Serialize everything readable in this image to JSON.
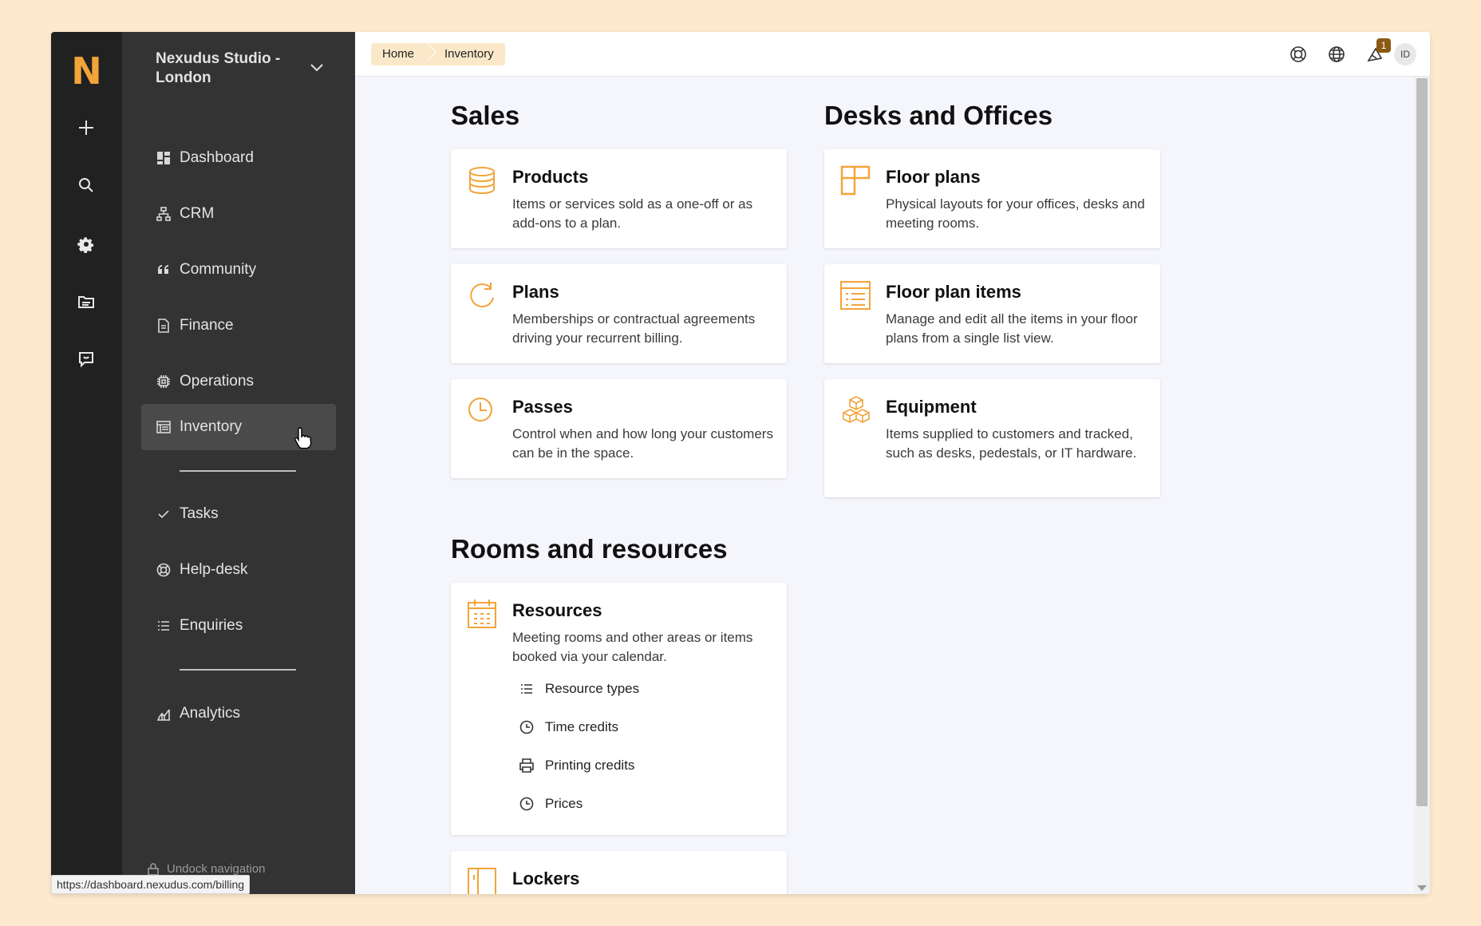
{
  "rail": {
    "logo": "N",
    "buttons": [
      "add-icon",
      "search-icon",
      "gear-icon",
      "folder-icon",
      "chat-icon"
    ]
  },
  "nav": {
    "location": "Nexudus Studio - London",
    "items": {
      "dashboard": "Dashboard",
      "crm": "CRM",
      "community": "Community",
      "finance": "Finance",
      "operations": "Operations",
      "inventory": "Inventory",
      "tasks": "Tasks",
      "helpdesk": "Help-desk",
      "enquiries": "Enquiries",
      "analytics": "Analytics"
    },
    "active": "Inventory",
    "undock": "Undock navigation"
  },
  "topbar": {
    "breadcrumb": [
      "Home",
      "Inventory"
    ],
    "notification_count": "1",
    "avatar": "ID"
  },
  "sections": {
    "sales": {
      "title": "Sales",
      "products": {
        "title": "Products",
        "desc": "Items or services sold as a one-off or as add-ons to a plan."
      },
      "plans": {
        "title": "Plans",
        "desc": "Memberships or contractual agreements driving your recurrent billing."
      },
      "passes": {
        "title": "Passes",
        "desc": "Control when and how long your customers can be in the space."
      }
    },
    "desks": {
      "title": "Desks and Offices",
      "floorplans": {
        "title": "Floor plans",
        "desc": "Physical layouts for your offices, desks and meeting rooms."
      },
      "floorplanitems": {
        "title": "Floor plan items",
        "desc": "Manage and edit all the items in your floor plans from a single list view."
      },
      "equipment": {
        "title": "Equipment",
        "desc": "Items supplied to customers and tracked, such as desks, pedestals, or IT hardware."
      }
    },
    "rooms": {
      "title": "Rooms and resources",
      "resources": {
        "title": "Resources",
        "desc": "Meeting rooms and other areas or items booked via your calendar.",
        "links": {
          "types": "Resource types",
          "time": "Time credits",
          "printing": "Printing credits",
          "prices": "Prices"
        }
      },
      "lockers": {
        "title": "Lockers"
      }
    }
  },
  "status_url": "https://dashboard.nexudus.com/billing",
  "colors": {
    "accent": "#f2a43a",
    "rail": "#212121",
    "nav": "#333333",
    "breadcrumb_bg": "#fbe8c8"
  }
}
